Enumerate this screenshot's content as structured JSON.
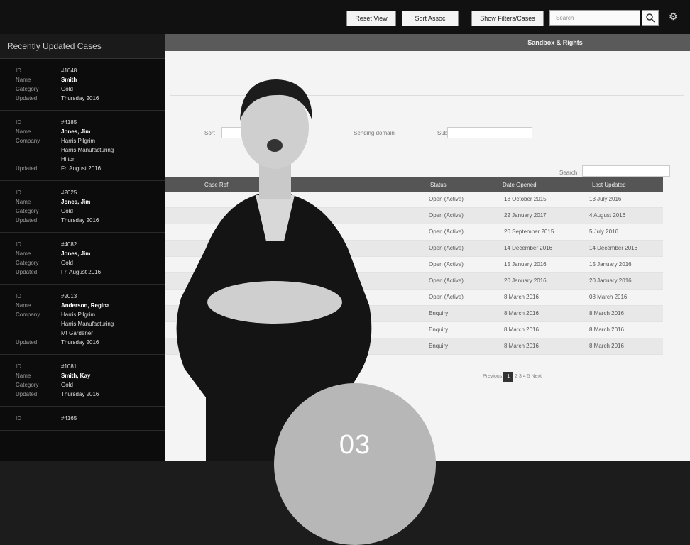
{
  "topbar": {
    "buttons": [
      "Reset View",
      "Sort Assoc",
      "Show Filters/Cases"
    ],
    "search_placeholder": "Search"
  },
  "sidebar": {
    "title": "Recently Updated Cases",
    "cases": [
      {
        "rows": [
          [
            "ID",
            "#1048"
          ],
          [
            "Name",
            "Smith"
          ],
          [
            "Category",
            "Gold"
          ],
          [
            "Updated",
            "Thursday 2016"
          ]
        ]
      },
      {
        "rows": [
          [
            "ID",
            "#4185"
          ],
          [
            "Name",
            "Jones, Jim"
          ],
          [
            "Company",
            "Harris Pilgrim"
          ],
          [
            "",
            "Harris Manufacturing"
          ],
          [
            "",
            "Hilton"
          ],
          [
            "Updated",
            "Fri August 2016"
          ]
        ]
      },
      {
        "rows": [
          [
            "ID",
            "#2025"
          ],
          [
            "Name",
            "Jones, Jim"
          ],
          [
            "Category",
            "Gold"
          ],
          [
            "Updated",
            "Thursday 2016"
          ]
        ]
      },
      {
        "rows": [
          [
            "ID",
            "#4082"
          ],
          [
            "Name",
            "Jones, Jim"
          ],
          [
            "Category",
            "Gold"
          ],
          [
            "Updated",
            "Fri August 2016"
          ]
        ]
      },
      {
        "rows": [
          [
            "ID",
            "#2013"
          ],
          [
            "Name",
            "Anderson, Regina"
          ],
          [
            "Company",
            "Harris Pilgrim"
          ],
          [
            "",
            "Harris Manufacturing"
          ],
          [
            "",
            "Mt Gardener"
          ],
          [
            "Updated",
            "Thursday 2016"
          ]
        ]
      },
      {
        "rows": [
          [
            "ID",
            "#1081"
          ],
          [
            "Name",
            "Smith, Kay"
          ],
          [
            "Category",
            "Gold"
          ],
          [
            "Updated",
            "Thursday 2016"
          ]
        ]
      },
      {
        "rows": [
          [
            "ID",
            "#4165"
          ]
        ]
      }
    ]
  },
  "main": {
    "banner": "Sandbox & Rights",
    "filters": {
      "label1": "Sort",
      "label2": "Sending domain",
      "label3": "Sub"
    },
    "search_label": "Search",
    "columns": [
      "Case Ref",
      "Status",
      "Date Opened",
      "Last Updated"
    ],
    "rows": [
      [
        "Open (Active)",
        "18 October 2015",
        "13 July 2016"
      ],
      [
        "Open (Active)",
        "22 January 2017",
        "4 August 2016"
      ],
      [
        "Open (Active)",
        "20 September 2015",
        "5 July 2016"
      ],
      [
        "Open (Active)",
        "14 December 2016",
        "14 December 2016"
      ],
      [
        "Open (Active)",
        "15 January 2016",
        "15 January 2016"
      ],
      [
        "Open (Active)",
        "20 January 2016",
        "20 January 2016"
      ],
      [
        "Open (Active)",
        "8 March 2016",
        "08 March 2016"
      ],
      [
        "Enquiry",
        "8 March 2016",
        "8 March 2016"
      ],
      [
        "Enquiry",
        "8 March 2016",
        "8 March 2016"
      ],
      [
        "Enquiry",
        "8 March 2016",
        "8 March 2016"
      ]
    ],
    "pager": {
      "prev": "Previous",
      "current": "1",
      "pages": "2 3 4 5",
      "next": "Next"
    }
  },
  "badge": {
    "number": "03",
    "color": "#f2b617"
  }
}
